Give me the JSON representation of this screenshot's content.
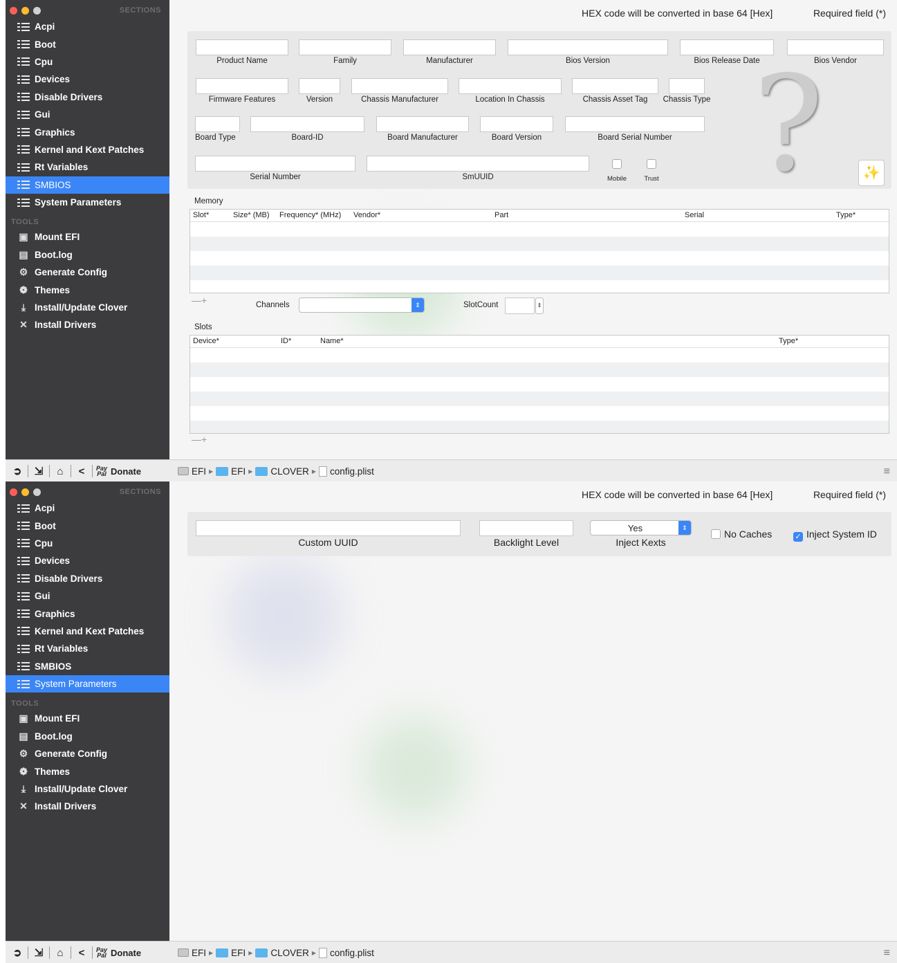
{
  "sidebar": {
    "sections_header": "SECTIONS",
    "sections": [
      "Acpi",
      "Boot",
      "Cpu",
      "Devices",
      "Disable Drivers",
      "Gui",
      "Graphics",
      "Kernel and Kext Patches",
      "Rt Variables",
      "SMBIOS",
      "System Parameters"
    ],
    "tools_header": "TOOLS",
    "tools": [
      {
        "label": "Mount EFI",
        "icon": "disk-icon"
      },
      {
        "label": "Boot.log",
        "icon": "log-icon"
      },
      {
        "label": "Generate Config",
        "icon": "gears-icon"
      },
      {
        "label": "Themes",
        "icon": "palette-icon"
      },
      {
        "label": "Install/Update Clover",
        "icon": "download-icon"
      },
      {
        "label": "Install Drivers",
        "icon": "tools-icon"
      }
    ]
  },
  "bottom_bar": {
    "donate_label": "Donate",
    "paypal_line1": "Pay",
    "paypal_line2": "Pal",
    "path": [
      "EFI",
      "EFI",
      "CLOVER",
      "config.plist"
    ]
  },
  "notes": {
    "hex": "HEX code will be converted in base 64 [Hex]",
    "required": "Required field (*)"
  },
  "smbios": {
    "selected": "SMBIOS",
    "row1": [
      "Product Name",
      "Family",
      "Manufacturer",
      "Bios Version",
      "Bios Release Date",
      "Bios Vendor"
    ],
    "row2": [
      "Firmware Features",
      "Version",
      "Chassis Manufacturer",
      "Location In Chassis",
      "Chassis  Asset Tag",
      "Chassis Type"
    ],
    "row3": [
      "Board Type",
      "Board-ID",
      "Board Manufacturer",
      "Board Version",
      "Board Serial Number"
    ],
    "row4": [
      "Serial Number",
      "SmUUID"
    ],
    "checkboxes": [
      "Mobile",
      "Trust"
    ],
    "question_mark": "?",
    "memory": {
      "title": "Memory",
      "columns": [
        "Slot*",
        "Size* (MB)",
        "Frequency* (MHz)",
        "Vendor*",
        "Part",
        "Serial",
        "Type*"
      ],
      "channels_label": "Channels",
      "slotcount_label": "SlotCount",
      "add": "+"
    },
    "slots": {
      "title": "Slots",
      "columns": [
        "Device*",
        "ID*",
        "Name*",
        "Type*"
      ],
      "add": "+"
    }
  },
  "system_parameters": {
    "selected": "System Parameters",
    "custom_uuid_label": "Custom UUID",
    "backlight_label": "Backlight Level",
    "inject_kexts_label": "Inject Kexts",
    "inject_kexts_value": "Yes",
    "no_caches_label": "No Caches",
    "no_caches_checked": false,
    "inject_system_id_label": "Inject System ID",
    "inject_system_id_checked": true
  }
}
